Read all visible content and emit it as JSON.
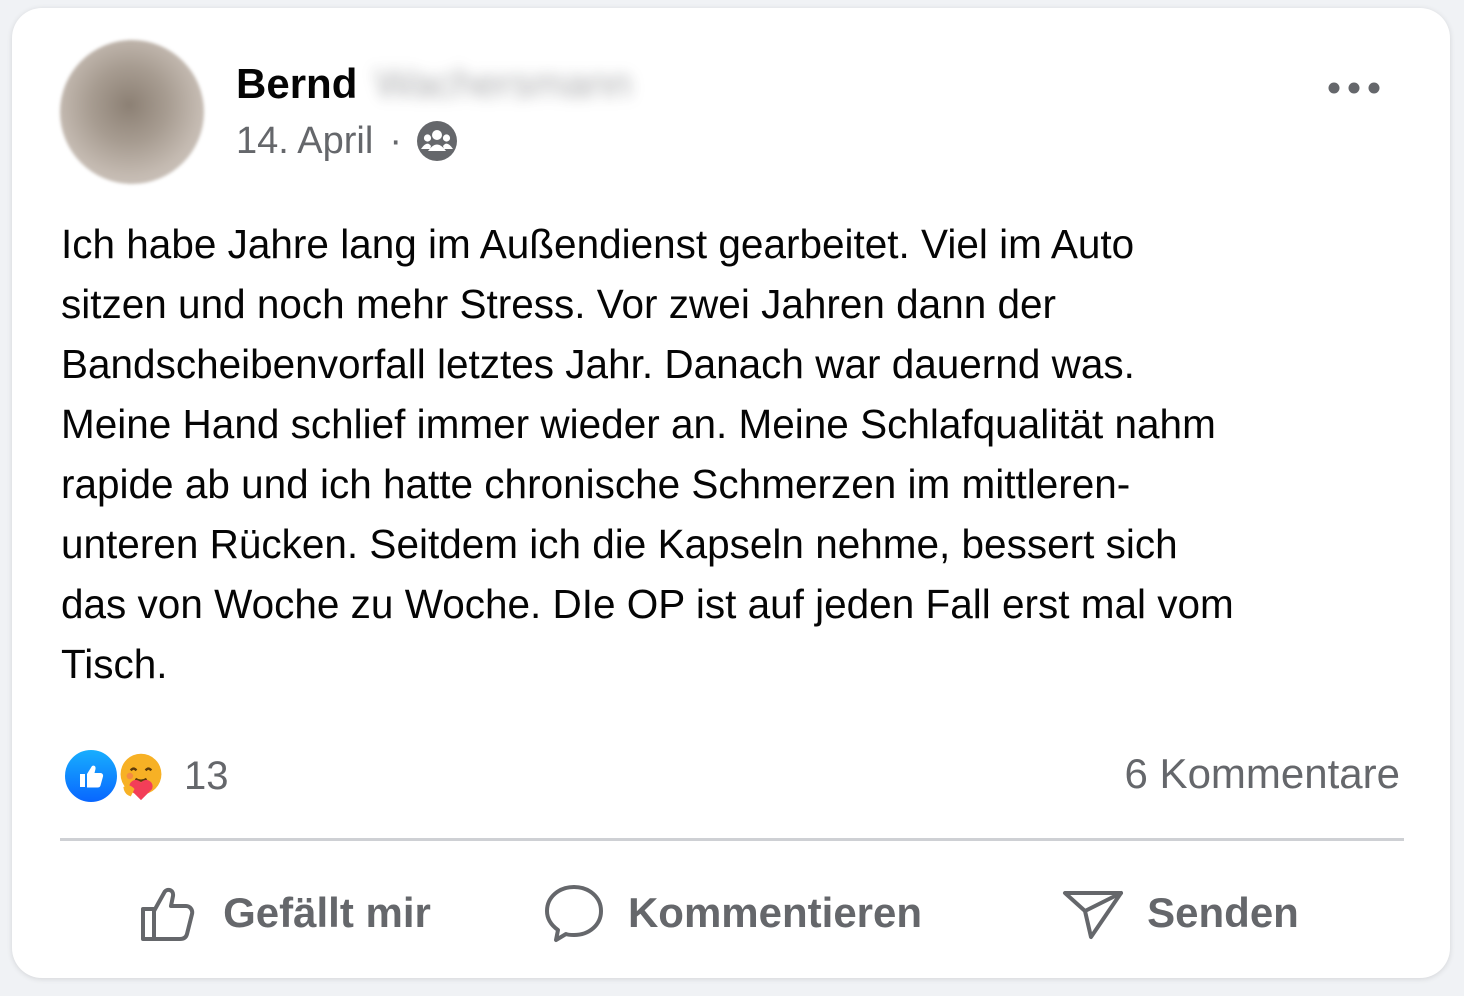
{
  "post": {
    "author_first": "Bernd",
    "author_last": "Wachersmann",
    "date": "14. April",
    "separator": "·",
    "audience_icon": "group-icon",
    "more_icon": "more-icon",
    "text": "Ich habe Jahre lang im Außendienst gearbeitet. Viel im Auto\nsitzen und noch mehr Stress. Vor zwei Jahren dann der\nBandscheibenvorfall letztes Jahr. Danach war dauernd was.\nMeine Hand schlief immer wieder an. Meine Schlafqualität nahm\nrapide ab und ich hatte chronische Schmerzen im mittleren-\nunteren Rücken. Seitdem ich die Kapseln nehme, bessert sich\ndas von Woche zu Woche. DIe OP ist auf jeden Fall erst mal vom\nTisch."
  },
  "stats": {
    "reaction_icons": [
      "like-reaction-icon",
      "care-reaction-icon"
    ],
    "reaction_count": "13",
    "comments_label": "6 Kommentare"
  },
  "actions": {
    "like_label": "Gefällt mir",
    "comment_label": "Kommentieren",
    "send_label": "Senden"
  },
  "colors": {
    "card_bg": "#ffffff",
    "page_bg": "#f0f2f5",
    "primary_text": "#050505",
    "secondary_text": "#65676b",
    "like_blue": "#0866ff",
    "divider": "#ced0d4"
  }
}
